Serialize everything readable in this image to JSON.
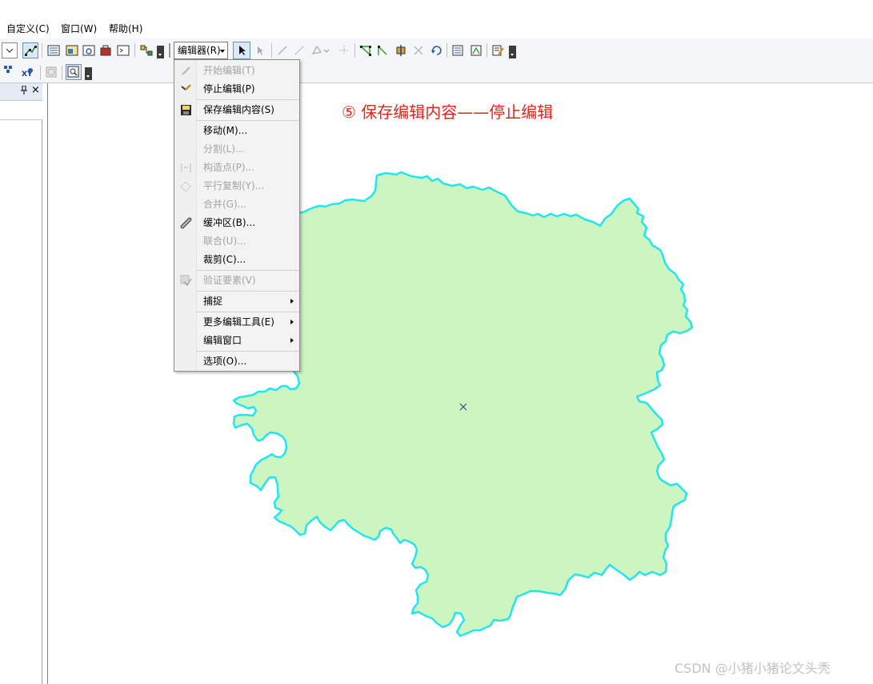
{
  "menubar": {
    "items": [
      "自定义(C)",
      "窗口(W)",
      "帮助(H)"
    ]
  },
  "toolbar": {
    "editor_dropdown_label": "编辑器(R)",
    "xy_label": "XY"
  },
  "left_panel": {
    "pin_symbol": " 📌",
    "pin_glyph": "❙",
    "close_glyph": "×"
  },
  "editor_menu": {
    "items": [
      {
        "label": "开始编辑(T)",
        "enabled": false,
        "icon": "pencil-icon"
      },
      {
        "label": "停止编辑(P)",
        "enabled": true,
        "icon": "stop-edit-icon"
      },
      {
        "label": "保存编辑内容(S)",
        "enabled": true,
        "icon": "save-edits-icon"
      },
      {
        "label": "移动(M)...",
        "enabled": true,
        "icon": ""
      },
      {
        "label": "分割(L)...",
        "enabled": false,
        "icon": ""
      },
      {
        "label": "构造点(P)...",
        "enabled": false,
        "icon": "construct-points-icon"
      },
      {
        "label": "平行复制(Y)...",
        "enabled": false,
        "icon": "copy-parallel-icon"
      },
      {
        "label": "合并(G)...",
        "enabled": false,
        "icon": ""
      },
      {
        "label": "缓冲区(B)...",
        "enabled": true,
        "icon": "buffer-icon"
      },
      {
        "label": "联合(U)...",
        "enabled": false,
        "icon": ""
      },
      {
        "label": "裁剪(C)...",
        "enabled": true,
        "icon": ""
      },
      {
        "label": "验证要素(V)",
        "enabled": false,
        "icon": "validate-icon"
      },
      {
        "label": "捕捉",
        "enabled": true,
        "icon": "",
        "submenu": true
      },
      {
        "label": "更多编辑工具(E)",
        "enabled": true,
        "icon": "",
        "submenu": true
      },
      {
        "label": "编辑窗口",
        "enabled": true,
        "icon": "",
        "submenu": true
      },
      {
        "label": "选项(O)...",
        "enabled": true,
        "icon": ""
      }
    ]
  },
  "map": {
    "annotation": "⑤ 保存编辑内容——停止编辑",
    "polygon_fill": "#ccf5c0",
    "polygon_stroke": "#21e6f2",
    "annotation_color": "#e8231a",
    "center_marker": "×"
  },
  "watermark": "CSDN @小猪小猪论文头秃"
}
